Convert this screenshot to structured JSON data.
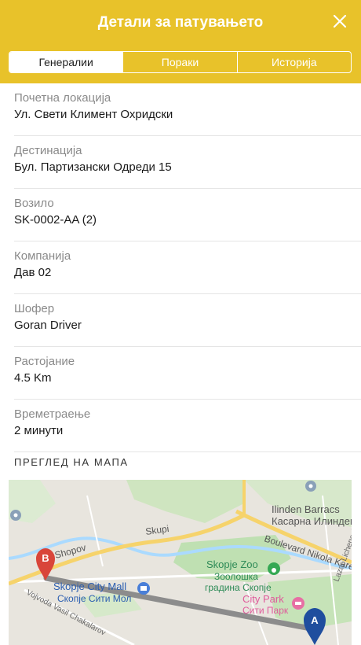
{
  "header": {
    "title": "Детали за патувањето",
    "tabs": [
      {
        "label": "Генералии"
      },
      {
        "label": "Пораки"
      },
      {
        "label": "Историја"
      }
    ]
  },
  "details": [
    {
      "label": "Почетна локација",
      "value": "Ул. Свети Климент Охридски"
    },
    {
      "label": "Дестинација",
      "value": "Бул. Партизански Одреди 15"
    },
    {
      "label": "Возило",
      "value": "SK-0002-AA (2)"
    },
    {
      "label": "Компанија",
      "value": "Дав 02"
    },
    {
      "label": "Шофер",
      "value": "Goran Driver"
    },
    {
      "label": "Растојание",
      "value": "4.5 Km"
    },
    {
      "label": "Времетраење",
      "value": "2 минути"
    }
  ],
  "map": {
    "section_title": "ПРЕГЛЕД НА МАПА",
    "labels": {
      "barracks_en": "Ilinden Barracs",
      "barracks_mk": "Касарна Илинден",
      "skupi": "Skupi",
      "shopov": "Shopov",
      "boulevard": "Boulevard Nikola Kare",
      "zoo_en": "Skopje Zoo",
      "zoo_mk1": "Зоолошка",
      "zoo_mk2": "градина Скопје",
      "mall_en": "Skopje City Mall",
      "mall_mk": "Скопје Сити Мол",
      "park_en": "City Park",
      "park_mk": "Сити Парк",
      "vojvoda": "Vojvoda Vasil Chakalarov",
      "lazar": "Lazar Lichenoski",
      "marker_b": "B",
      "marker_a": "A"
    }
  }
}
